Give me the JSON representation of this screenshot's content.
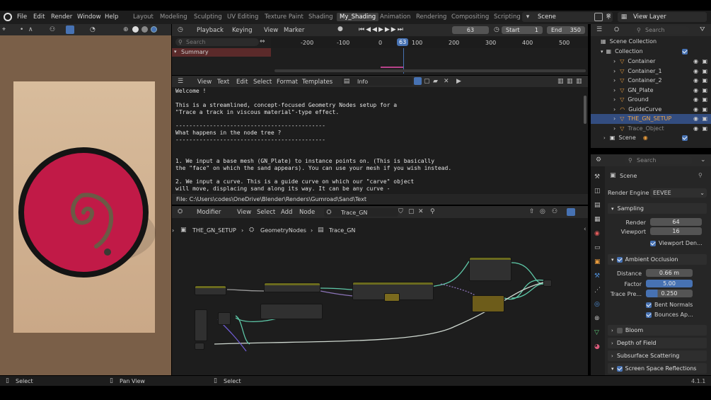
{
  "menubar": {
    "items": [
      "File",
      "Edit",
      "Render",
      "Window",
      "Help"
    ],
    "workspaces": [
      "Layout",
      "Modeling",
      "Sculpting",
      "UV Editing",
      "Texture Paint",
      "Shading",
      "My_Shading",
      "Animation",
      "Rendering",
      "Compositing",
      "Scripting"
    ],
    "active_workspace": "My_Shading",
    "scene_name": "Scene",
    "view_layer": "View Layer"
  },
  "timeline": {
    "menus": [
      "Playback",
      "Keying",
      "View",
      "Marker"
    ],
    "current_frame": "63",
    "start_label": "Start",
    "start_value": "1",
    "end_label": "End",
    "end_value": "350",
    "search_placeholder": "Search",
    "channel": "Summary",
    "ruler": [
      "-200",
      "-100",
      "0",
      "63",
      "100",
      "200",
      "300",
      "400",
      "500"
    ]
  },
  "text_editor": {
    "menus": [
      "View",
      "Text",
      "Edit",
      "Select",
      "Format",
      "Templates"
    ],
    "datablock": "Info",
    "lines": [
      "Welcome !",
      "",
      "This is a streamlined, concept-focused Geometry Nodes setup for a",
      "\"Trace a track in viscous material\"-type effect.",
      "",
      "--------------------------------------------",
      "What happens in the node tree ?",
      "--------------------------------------------",
      "",
      "",
      "1. We input a base mesh (GN_Plate) to instance points on. (This is basically",
      "the \"face\" on which the sand appears). You can use your mesh if you wish instead.",
      "",
      "2. We input a curve. This is a guide curve on which our \"carve\" object",
      "will move, displacing sand along its way. It can be any curve -"
    ],
    "footer": "File: C:\\Users\\codes\\OneDrive\\Blender\\Renders\\Gumroad\\Sand\\Text"
  },
  "node_editor": {
    "menus": [
      "Modifier",
      "View",
      "Select",
      "Add",
      "Node"
    ],
    "tree_name": "Trace_GN",
    "breadcrumb": [
      "THE_GN_SETUP",
      "GeometryNodes",
      "Trace_GN"
    ]
  },
  "outliner": {
    "search_placeholder": "Search",
    "root": "Scene Collection",
    "collection": "Collection",
    "items": [
      {
        "name": "Container",
        "selected": false
      },
      {
        "name": "Container_1",
        "selected": false
      },
      {
        "name": "Container_2",
        "selected": false
      },
      {
        "name": "GN_Plate",
        "selected": false
      },
      {
        "name": "Ground",
        "selected": false
      },
      {
        "name": "GuideCurve",
        "selected": false
      },
      {
        "name": "THE_GN_SETUP",
        "selected": true
      },
      {
        "name": "Trace_Object",
        "selected": false
      }
    ],
    "scene_item": "Scene"
  },
  "properties": {
    "search_placeholder": "Search",
    "context": "Scene",
    "render_engine_label": "Render Engine",
    "render_engine": "EEVEE",
    "sampling": {
      "title": "Sampling",
      "render_label": "Render",
      "render_value": "64",
      "viewport_label": "Viewport",
      "viewport_value": "16",
      "denoise_label": "Viewport Den..."
    },
    "ao": {
      "title": "Ambient Occlusion",
      "distance_label": "Distance",
      "distance_value": "0.66 m",
      "factor_label": "Factor",
      "factor_value": "5.00",
      "trace_label": "Trace Pre...",
      "trace_value": "0.250",
      "bent_label": "Bent Normals",
      "bounces_label": "Bounces Ap..."
    },
    "sections": [
      "Bloom",
      "Depth of Field",
      "Subsurface Scattering",
      "Screen Space Reflections"
    ]
  },
  "statusbar": {
    "items": [
      "Select",
      "Pan View",
      "Select"
    ],
    "version": "4.1.1"
  },
  "colors": {
    "accent": "#4772b3",
    "selected_row": "#334d80",
    "orange_object": "#e89b3c",
    "plate_red": "#d92356",
    "node_line": "#5ec8a8"
  }
}
